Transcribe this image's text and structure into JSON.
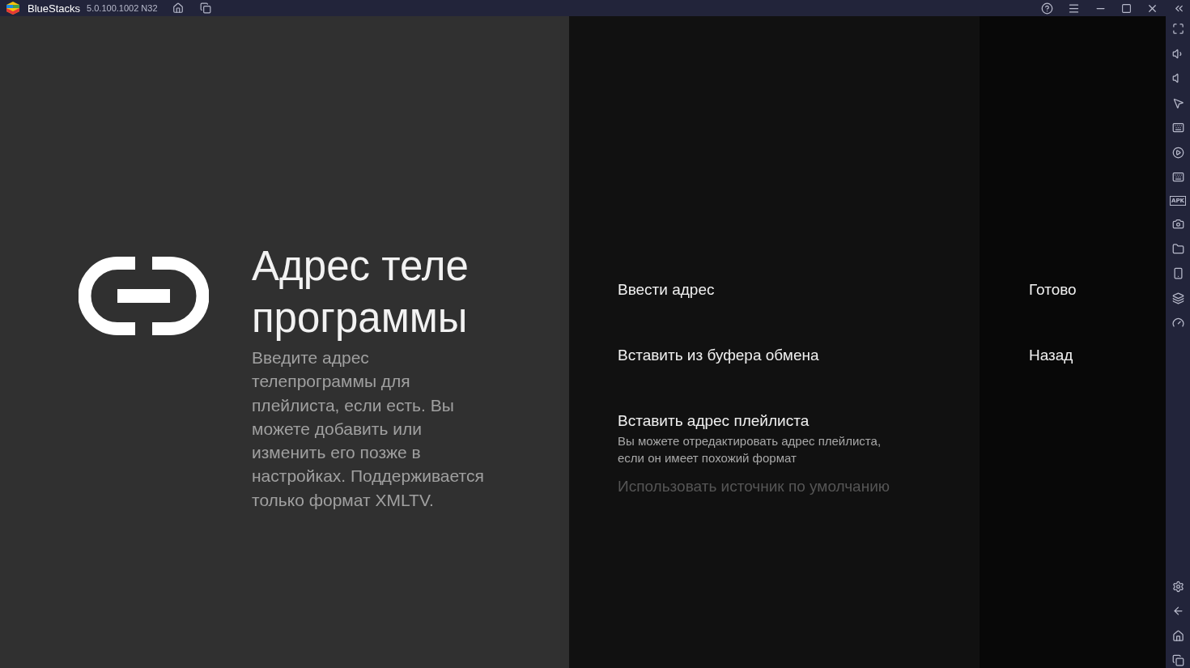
{
  "titlebar": {
    "app_name": "BlueStacks",
    "version": "5.0.100.1002 N32"
  },
  "guide": {
    "title_lines": [
      "Адрес теле",
      "программы"
    ],
    "description": "Введите адрес телепрограммы для плейлиста, если есть. Вы можете добавить или изменить его позже в настройках. Поддерживается только формат XMLTV."
  },
  "actions": [
    {
      "label": "Ввести адрес",
      "disabled": false
    },
    {
      "label": "Вставить из буфера обмена",
      "disabled": false
    },
    {
      "label": "Вставить адрес плейлиста",
      "description": "Вы можете отредактировать адрес плейлиста, если он имеет похожий формат",
      "disabled": false
    },
    {
      "label": "Использовать источник по умолчанию",
      "disabled": true
    }
  ],
  "buttons": [
    "Готово",
    "Назад"
  ],
  "sidebar": {
    "apk_label": "APK"
  }
}
